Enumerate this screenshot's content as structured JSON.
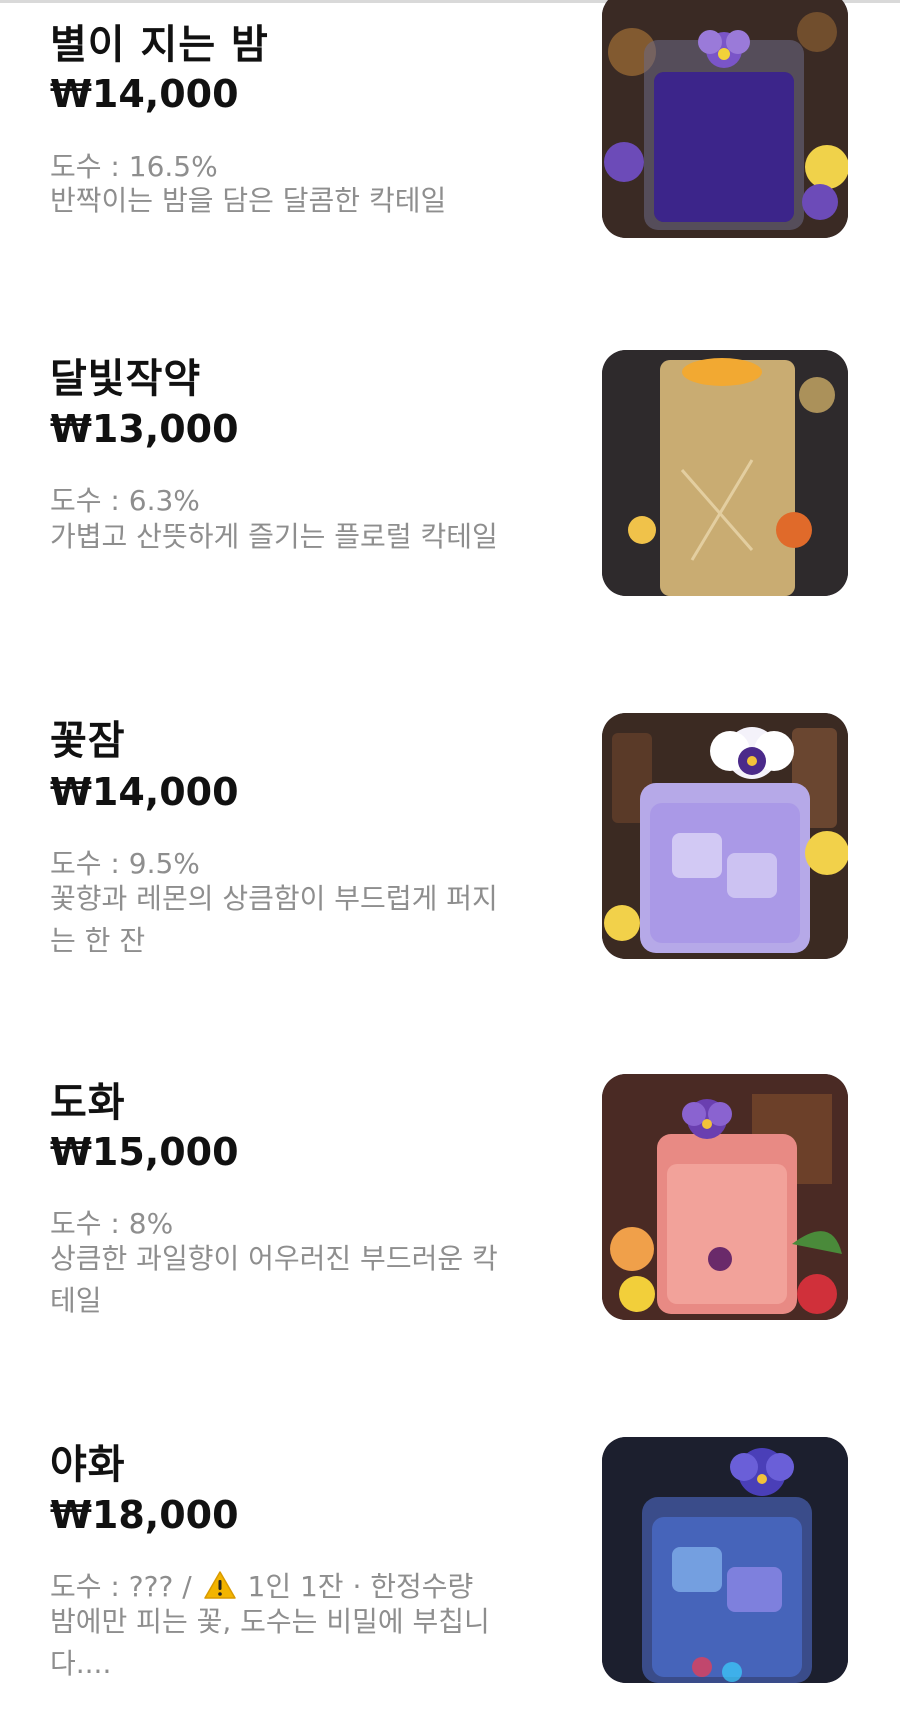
{
  "menu": {
    "items": [
      {
        "name": "별이 지는 밤",
        "price": "₩14,000",
        "abv": "도수 : 16.5%",
        "description": "반짝이는 밤을 담은 달콤한 칵테일",
        "image_icon": "cocktail-photo-icon"
      },
      {
        "name": "달빛작약",
        "price": "₩13,000",
        "abv": "도수 : 6.3%",
        "description": "가볍고 산뜻하게 즐기는 플로럴 칵테일",
        "image_icon": "cocktail-photo-icon"
      },
      {
        "name": "꽃잠",
        "price": "₩14,000",
        "abv": "도수 : 9.5%",
        "description": "꽃향과 레몬의 상큼함이 부드럽게 퍼지는 한 잔",
        "image_icon": "cocktail-photo-icon"
      },
      {
        "name": "도화",
        "price": "₩15,000",
        "abv": "도수 : 8%",
        "description": "상큼한 과일향이 어우러진 부드러운 칵테일",
        "image_icon": "cocktail-photo-icon"
      },
      {
        "name": "야화",
        "price": "₩18,000",
        "abv_prefix": "도수 : ??? /",
        "abv_suffix": "1인 1잔 · 한정수량",
        "warning_icon": "warning-icon",
        "description": "밤에만 피는 꽃, 도수는 비밀에 부칩니다....",
        "image_icon": "cocktail-photo-icon"
      }
    ]
  },
  "colors": {
    "text_primary": "#111111",
    "text_secondary": "#8e8e8e",
    "warning": "#f2b400"
  }
}
